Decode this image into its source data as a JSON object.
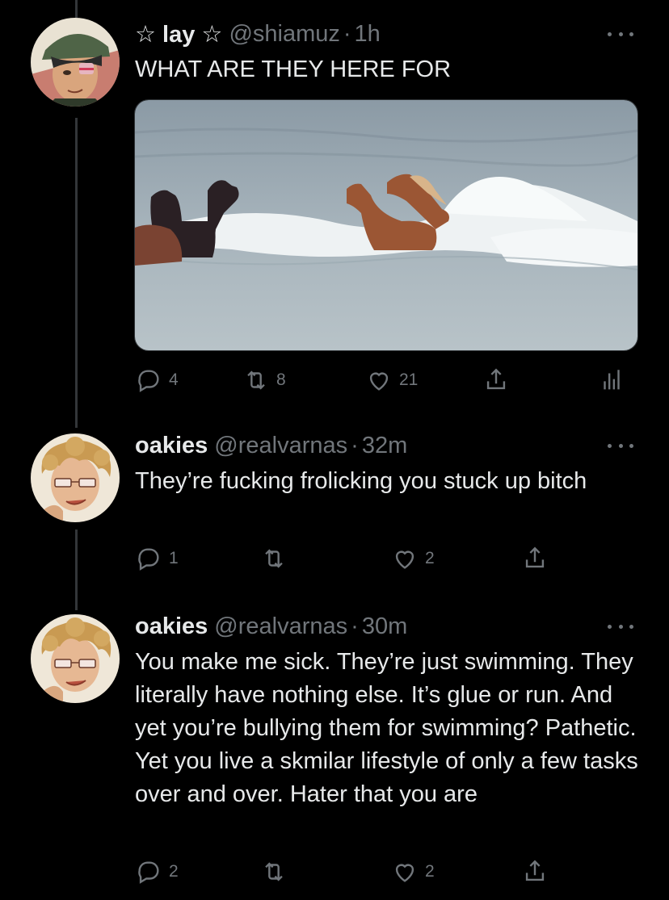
{
  "tweets": [
    {
      "display_name": "☆ lay ☆",
      "handle": "@shiamuz",
      "dot": "·",
      "time": "1h",
      "text": "WHAT ARE THEY HERE FOR",
      "avatar_icon": "anime-avatar-green-cap-icon",
      "media_icon": "horses-swimming-in-surf-photo",
      "replies": "4",
      "retweets": "8",
      "likes": "21"
    },
    {
      "display_name": "oakies",
      "handle": "@realvarnas",
      "dot": "·",
      "time": "32m",
      "text": "They’re fucking frolicking you stuck up bitch",
      "avatar_icon": "anime-avatar-curly-blond-icon",
      "replies": "1",
      "retweets": "",
      "likes": "2"
    },
    {
      "display_name": "oakies",
      "handle": "@realvarnas",
      "dot": "·",
      "time": "30m",
      "text": "You make me sick. They’re just swimming. They literally have nothing else. It’s glue or run. And yet you’re bullying them for swimming? Pathetic. Yet you live a skmilar lifestyle of only a few tasks over and over. Hater that you are",
      "avatar_icon": "anime-avatar-curly-blond-icon",
      "replies": "2",
      "retweets": "",
      "likes": "2"
    }
  ],
  "colors": {
    "background": "#000000",
    "text": "#e7e9ea",
    "secondary": "#71767b",
    "thread_line": "#333639"
  }
}
